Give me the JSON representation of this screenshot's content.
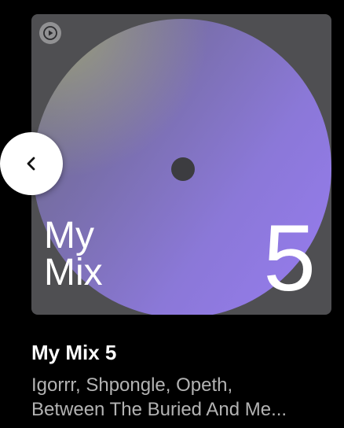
{
  "cover": {
    "title_line1": "My",
    "title_line2": "Mix",
    "number": "5",
    "badge_icon": "play-circle-icon",
    "colors": {
      "disc_start": "#6a6a82",
      "disc_end": "#977cf0",
      "background": "#4f4f52"
    }
  },
  "back_button": {
    "icon": "chevron-left-icon"
  },
  "mix": {
    "title": "My Mix 5",
    "subtitle_line1": "Igorrr, Shpongle, Opeth,",
    "subtitle_line2": "Between The Buried And Me..."
  }
}
